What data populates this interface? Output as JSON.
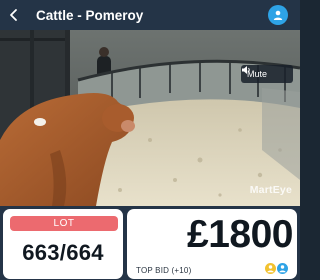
{
  "header": {
    "title": "Cattle - Pomeroy",
    "back_icon": "chevron-left-icon",
    "user_icon": "user-avatar-icon"
  },
  "video": {
    "mute_label": "Mute",
    "mute_icon": "speaker-icon",
    "watermark": "MartEye"
  },
  "lot": {
    "badge": "LOT",
    "number": "663/664"
  },
  "bid": {
    "amount": "£1800",
    "label": "TOP BID (+10)",
    "bidder_icons": [
      "bidder-avatar-icon",
      "bidder-avatar-icon"
    ]
  },
  "colors": {
    "header_bg": "#243447",
    "accent_blue": "#2ea3e6",
    "lot_badge": "#ec6a6f",
    "card_bg": "#ffffff",
    "bidder_yellow": "#f2c230",
    "bidder_blue": "#2ea3e6"
  }
}
